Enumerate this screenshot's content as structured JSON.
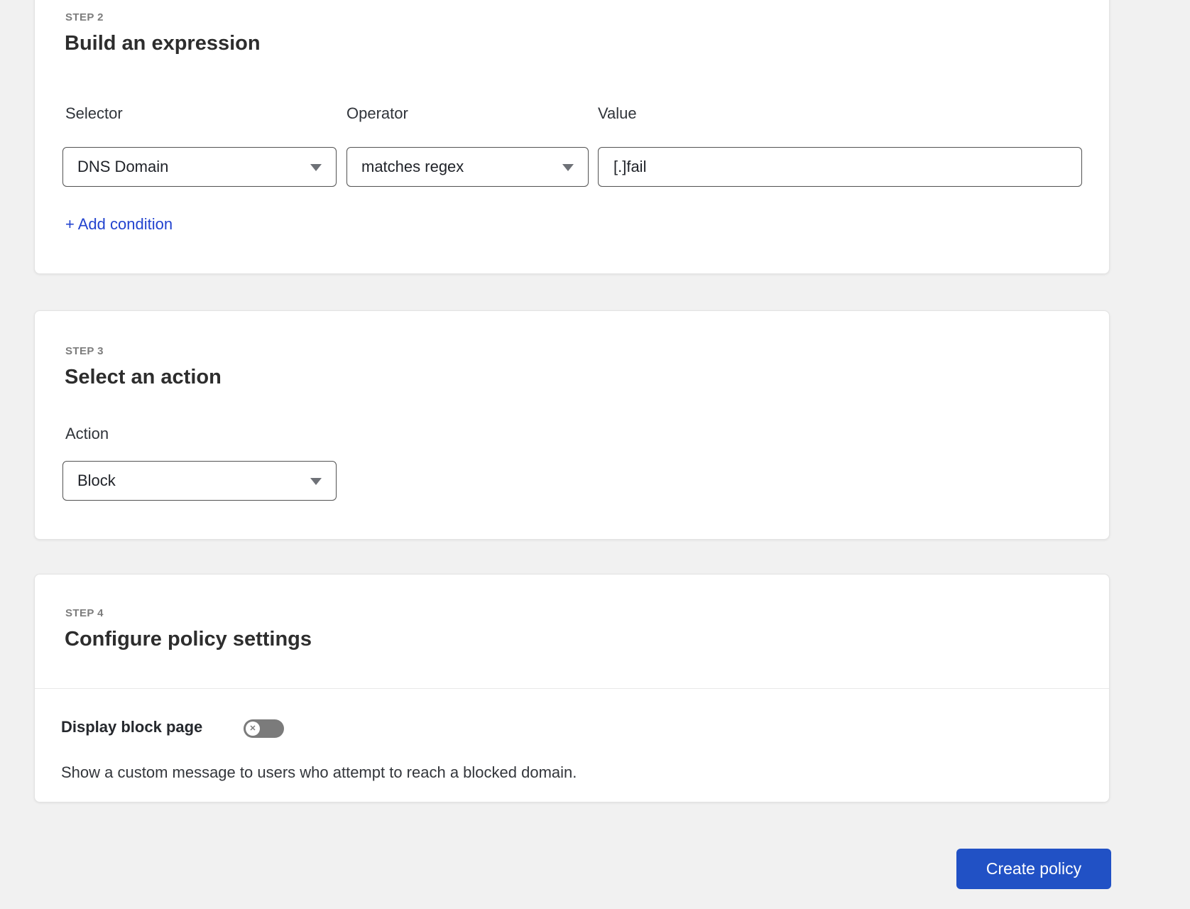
{
  "colors": {
    "page_background": "#f1f1f1",
    "card_background": "#ffffff",
    "link_blue": "#2243cf",
    "button_blue": "#2151c5",
    "toggle_off_gray": "#7b7b7b",
    "field_border": "#525252"
  },
  "step2": {
    "step_label": "STEP 2",
    "title": "Build an expression",
    "fields": {
      "selector": {
        "label": "Selector",
        "value": "DNS Domain"
      },
      "operator": {
        "label": "Operator",
        "value": "matches regex"
      },
      "value": {
        "label": "Value",
        "value": "[.]fail"
      }
    },
    "add_condition_label": "+ Add condition"
  },
  "step3": {
    "step_label": "STEP 3",
    "title": "Select an action",
    "action": {
      "label": "Action",
      "value": "Block"
    }
  },
  "step4": {
    "step_label": "STEP 4",
    "title": "Configure policy settings",
    "display_block_page": {
      "label": "Display block page",
      "state": "off",
      "knob_glyph": "✕"
    },
    "description": "Show a custom message to users who attempt to reach a blocked domain."
  },
  "footer": {
    "create_button_label": "Create policy"
  }
}
